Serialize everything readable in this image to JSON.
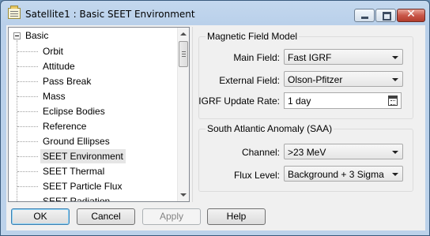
{
  "window": {
    "title": "Satellite1 : Basic SEET Environment"
  },
  "tree": {
    "root": "Basic",
    "items": [
      {
        "label": "Orbit",
        "selected": false
      },
      {
        "label": "Attitude",
        "selected": false
      },
      {
        "label": "Pass Break",
        "selected": false
      },
      {
        "label": "Mass",
        "selected": false
      },
      {
        "label": "Eclipse Bodies",
        "selected": false
      },
      {
        "label": "Reference",
        "selected": false
      },
      {
        "label": "Ground Ellipses",
        "selected": false
      },
      {
        "label": "SEET Environment",
        "selected": true
      },
      {
        "label": "SEET Thermal",
        "selected": false
      },
      {
        "label": "SEET Particle Flux",
        "selected": false
      },
      {
        "label": "SEET Radiation",
        "selected": false
      }
    ]
  },
  "magnetic": {
    "title": "Magnetic Field Model",
    "main_field_label": "Main Field:",
    "main_field_value": "Fast IGRF",
    "external_field_label": "External Field:",
    "external_field_value": "Olson-Pfitzer",
    "igrf_rate_label": "IGRF Update Rate:",
    "igrf_rate_value": "1 day"
  },
  "saa": {
    "title": "South Atlantic Anomaly (SAA)",
    "channel_label": "Channel:",
    "channel_value": ">23 MeV",
    "flux_label": "Flux Level:",
    "flux_value": "Background + 3 Sigma"
  },
  "buttons": {
    "ok": "OK",
    "cancel": "Cancel",
    "apply": "Apply",
    "help": "Help"
  },
  "icons": {
    "app": "notepad-icon",
    "calendar": "calendar-icon"
  }
}
